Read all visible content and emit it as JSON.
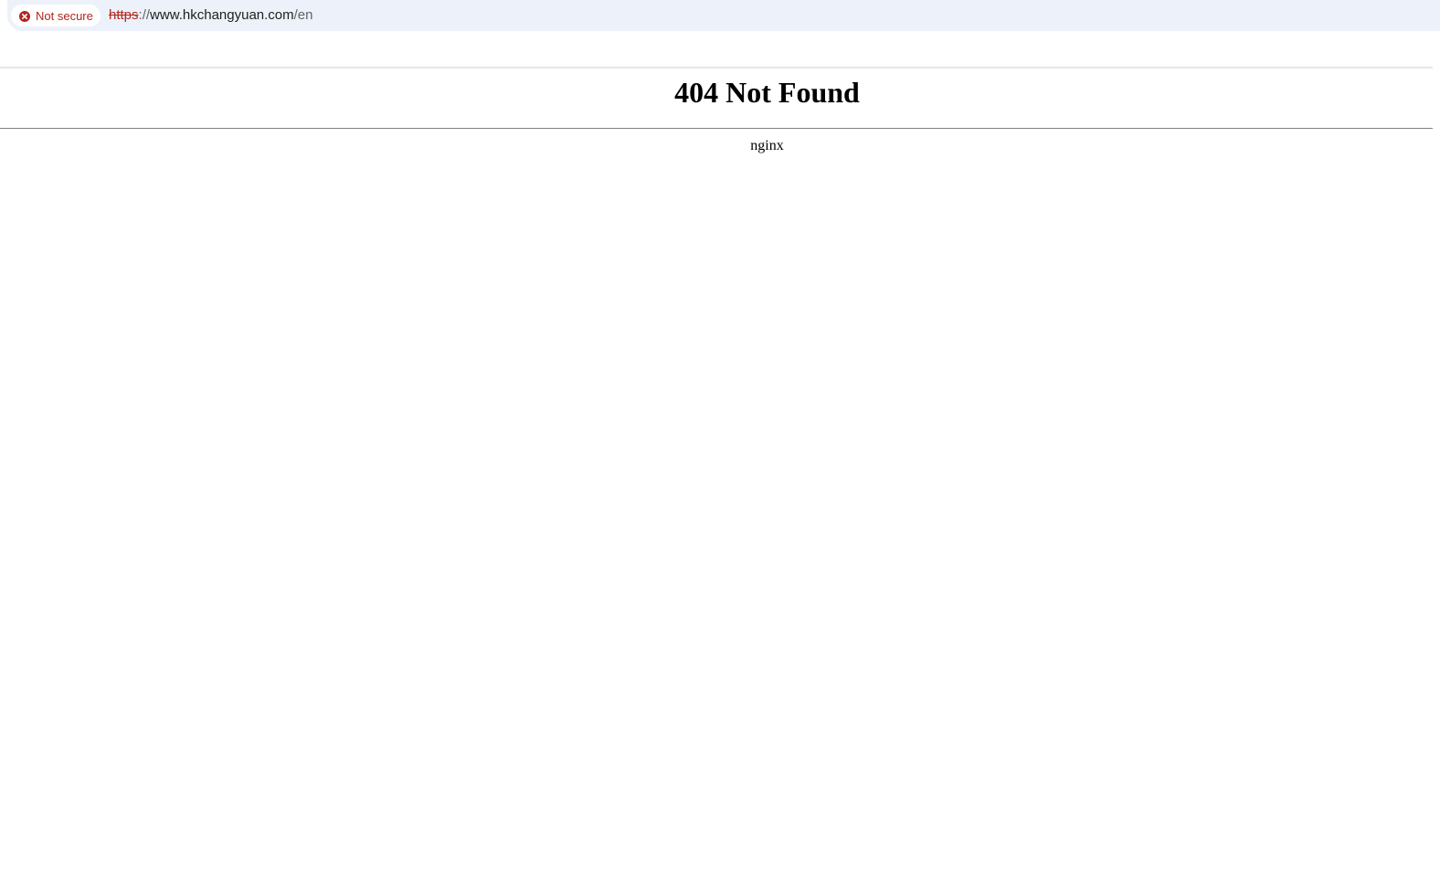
{
  "browser": {
    "security_label": "Not secure",
    "security_icon": "error-circle-icon",
    "url": {
      "scheme": "https",
      "separator": "://",
      "host": "www.hkchangyuan.com",
      "path": "/en"
    },
    "colors": {
      "insecure": "#b3261e",
      "bar_background": "#edf1f9"
    }
  },
  "page": {
    "heading": "404 Not Found",
    "server": "nginx"
  }
}
